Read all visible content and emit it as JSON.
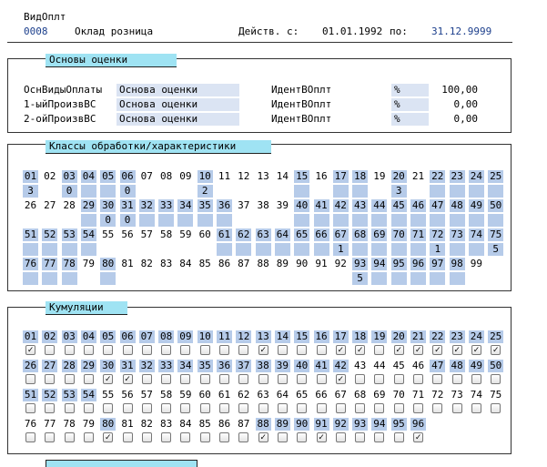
{
  "header": {
    "label": "ВидОплт",
    "code": "0008",
    "name": "Оклад розница",
    "valid_label": "Действ. с:",
    "valid_from": "01.01.1992",
    "to_label": "по:",
    "valid_to": "31.12.9999"
  },
  "basis": {
    "title": "Основы оценки",
    "rows": [
      {
        "label": "ОснВидыОплаты",
        "field": "Основа оценки",
        "ident": "ИдентВОплт",
        "unit": "%",
        "value": "100,00"
      },
      {
        "label": "1-ыйПроизвВС",
        "field": "Основа оценки",
        "ident": "ИдентВОплт",
        "unit": "%",
        "value": "0,00"
      },
      {
        "label": "2-ойПроизвВС",
        "field": "Основа оценки",
        "ident": "ИдентВОплт",
        "unit": "%",
        "value": "0,00"
      }
    ]
  },
  "classes": {
    "title": "Классы обработки/характеристики",
    "rows": [
      {
        "nums": [
          "01",
          "02",
          "03",
          "04",
          "05",
          "06",
          "07",
          "08",
          "09",
          "10",
          "11",
          "12",
          "13",
          "14",
          "15",
          "16",
          "17",
          "18",
          "19",
          "20",
          "21",
          "22",
          "23",
          "24",
          "25"
        ],
        "hl": [
          1,
          0,
          1,
          1,
          1,
          1,
          0,
          0,
          0,
          1,
          0,
          0,
          0,
          0,
          1,
          0,
          1,
          1,
          0,
          1,
          0,
          1,
          1,
          1,
          1
        ],
        "vals": [
          "3",
          "",
          "0",
          "",
          "",
          "0",
          "",
          "",
          "",
          "2",
          "",
          "",
          "",
          "",
          "",
          "",
          "",
          "",
          "",
          "3",
          "",
          "",
          "",
          "",
          ""
        ]
      },
      {
        "nums": [
          "26",
          "27",
          "28",
          "29",
          "30",
          "31",
          "32",
          "33",
          "34",
          "35",
          "36",
          "37",
          "38",
          "39",
          "40",
          "41",
          "42",
          "43",
          "44",
          "45",
          "46",
          "47",
          "48",
          "49",
          "50"
        ],
        "hl": [
          0,
          0,
          0,
          1,
          1,
          1,
          1,
          1,
          1,
          1,
          1,
          0,
          0,
          0,
          1,
          1,
          1,
          1,
          1,
          1,
          1,
          1,
          1,
          1,
          1
        ],
        "vals": [
          "",
          "",
          "",
          "",
          "0",
          "0",
          "",
          "",
          "",
          "",
          "",
          "",
          "",
          "",
          "",
          "",
          "",
          "",
          "",
          "",
          "",
          "",
          "",
          "",
          ""
        ]
      },
      {
        "nums": [
          "51",
          "52",
          "53",
          "54",
          "55",
          "56",
          "57",
          "58",
          "59",
          "60",
          "61",
          "62",
          "63",
          "64",
          "65",
          "66",
          "67",
          "68",
          "69",
          "70",
          "71",
          "72",
          "73",
          "74",
          "75"
        ],
        "hl": [
          1,
          1,
          1,
          1,
          0,
          0,
          0,
          0,
          0,
          0,
          1,
          1,
          1,
          1,
          1,
          1,
          1,
          1,
          1,
          1,
          1,
          1,
          1,
          1,
          1
        ],
        "vals": [
          "",
          "",
          "",
          "",
          "",
          "",
          "",
          "",
          "",
          "",
          "",
          "",
          "",
          "",
          "",
          "",
          "1",
          "",
          "",
          "",
          "",
          "1",
          "",
          "",
          "5"
        ]
      },
      {
        "nums": [
          "76",
          "77",
          "78",
          "79",
          "80",
          "81",
          "82",
          "83",
          "84",
          "85",
          "86",
          "87",
          "88",
          "89",
          "90",
          "91",
          "92",
          "93",
          "94",
          "95",
          "96",
          "97",
          "98",
          "99"
        ],
        "hl": [
          1,
          1,
          1,
          0,
          1,
          0,
          0,
          0,
          0,
          0,
          0,
          0,
          0,
          0,
          0,
          0,
          0,
          1,
          1,
          1,
          1,
          1,
          1,
          0
        ],
        "vals": [
          "",
          "",
          "",
          "",
          "",
          "",
          "",
          "",
          "",
          "",
          "",
          "",
          "",
          "",
          "",
          "",
          "",
          "5",
          "",
          "",
          "",
          "",
          "",
          ""
        ]
      }
    ]
  },
  "cumulations": {
    "title": "Кумуляции",
    "rows": [
      {
        "nums": [
          "01",
          "02",
          "03",
          "04",
          "05",
          "06",
          "07",
          "08",
          "09",
          "10",
          "11",
          "12",
          "13",
          "14",
          "15",
          "16",
          "17",
          "18",
          "19",
          "20",
          "21",
          "22",
          "23",
          "24",
          "25"
        ],
        "hl": [
          1,
          1,
          1,
          1,
          1,
          1,
          1,
          1,
          1,
          1,
          1,
          1,
          1,
          1,
          1,
          1,
          1,
          1,
          1,
          1,
          1,
          1,
          1,
          1,
          1
        ],
        "chk": [
          1,
          0,
          0,
          0,
          0,
          0,
          0,
          0,
          0,
          0,
          0,
          0,
          1,
          0,
          0,
          0,
          1,
          1,
          0,
          1,
          1,
          1,
          1,
          1,
          1
        ]
      },
      {
        "nums": [
          "26",
          "27",
          "28",
          "29",
          "30",
          "31",
          "32",
          "33",
          "34",
          "35",
          "36",
          "37",
          "38",
          "39",
          "40",
          "41",
          "42",
          "43",
          "44",
          "45",
          "46",
          "47",
          "48",
          "49",
          "50"
        ],
        "hl": [
          1,
          1,
          1,
          1,
          1,
          1,
          1,
          1,
          1,
          1,
          1,
          1,
          1,
          1,
          1,
          1,
          1,
          0,
          0,
          0,
          0,
          1,
          1,
          1,
          1
        ],
        "chk": [
          0,
          0,
          0,
          0,
          1,
          1,
          0,
          0,
          0,
          0,
          0,
          0,
          0,
          0,
          0,
          0,
          1,
          0,
          0,
          0,
          0,
          0,
          0,
          0,
          0
        ]
      },
      {
        "nums": [
          "51",
          "52",
          "53",
          "54",
          "55",
          "56",
          "57",
          "58",
          "59",
          "60",
          "61",
          "62",
          "63",
          "64",
          "65",
          "66",
          "67",
          "68",
          "69",
          "70",
          "71",
          "72",
          "73",
          "74",
          "75"
        ],
        "hl": [
          1,
          1,
          1,
          1,
          0,
          0,
          0,
          0,
          0,
          0,
          0,
          0,
          0,
          0,
          0,
          0,
          0,
          0,
          0,
          0,
          0,
          0,
          0,
          0,
          0
        ],
        "chk": [
          0,
          0,
          0,
          0,
          0,
          0,
          0,
          0,
          0,
          0,
          0,
          0,
          0,
          0,
          0,
          0,
          0,
          0,
          0,
          0,
          0,
          0,
          0,
          0,
          0
        ]
      },
      {
        "nums": [
          "76",
          "77",
          "78",
          "79",
          "80",
          "81",
          "82",
          "83",
          "84",
          "85",
          "86",
          "87",
          "88",
          "89",
          "90",
          "91",
          "92",
          "93",
          "94",
          "95",
          "96"
        ],
        "hl": [
          0,
          0,
          0,
          0,
          1,
          0,
          0,
          0,
          0,
          0,
          0,
          0,
          1,
          1,
          1,
          1,
          1,
          1,
          1,
          1,
          1
        ],
        "chk": [
          0,
          0,
          0,
          0,
          1,
          0,
          0,
          0,
          0,
          0,
          0,
          0,
          1,
          0,
          0,
          1,
          0,
          0,
          0,
          0,
          1
        ]
      }
    ]
  }
}
